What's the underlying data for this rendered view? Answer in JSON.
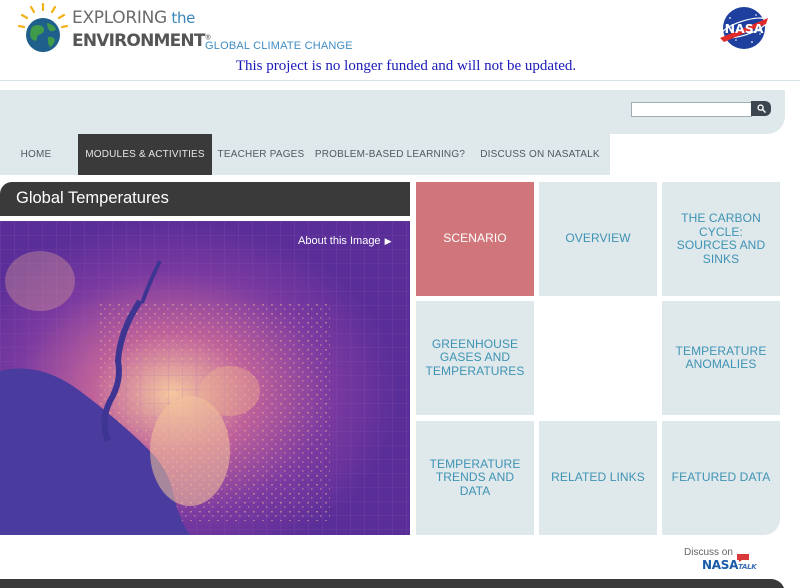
{
  "header": {
    "logo": {
      "line1_prefix": "EXPLORING",
      "line1_suffix": " the",
      "line2": "ENVIRONMENT",
      "trademark": "®",
      "subtitle": "GLOBAL CLIMATE CHANGE"
    },
    "nasa_logo_text": "NASA",
    "notice": "This project is no longer funded and will not be updated."
  },
  "search": {
    "value": "",
    "placeholder": ""
  },
  "nav": {
    "items": [
      {
        "label": "HOME",
        "active": false
      },
      {
        "label": "MODULES & ACTIVITIES",
        "active": true
      },
      {
        "label": "TEACHER PAGES",
        "active": false
      },
      {
        "label": "PROBLEM-BASED LEARNING?",
        "active": false
      },
      {
        "label": "DISCUSS ON NASATALK",
        "active": false
      }
    ]
  },
  "hero": {
    "title": "Global Temperatures",
    "about_link": "About this Image"
  },
  "tiles": [
    {
      "label": "SCENARIO",
      "active": true
    },
    {
      "label": "OVERVIEW",
      "active": false
    },
    {
      "label": "THE CARBON CYCLE: SOURCES AND SINKS",
      "active": false
    },
    {
      "label": "GREENHOUSE GASES AND TEMPERATURES",
      "active": false
    },
    {
      "label": "TEMPERATURE ANOMALIES",
      "active": false
    },
    {
      "label": "TEMPERATURE TRENDS AND DATA",
      "active": false
    },
    {
      "label": "RELATED LINKS",
      "active": false
    },
    {
      "label": "FEATURED DATA",
      "active": false
    }
  ],
  "footer": {
    "discuss_prefix": "Discuss on",
    "nasatalk_main": "NASA",
    "nasatalk_sub": "TALK"
  },
  "colors": {
    "accent_tile": "#d0767a",
    "tile_bg": "#dfe8eb",
    "tile_text": "#3e93b4",
    "dark_bar": "#3a3a3a",
    "notice_text": "#1a1ab8"
  }
}
